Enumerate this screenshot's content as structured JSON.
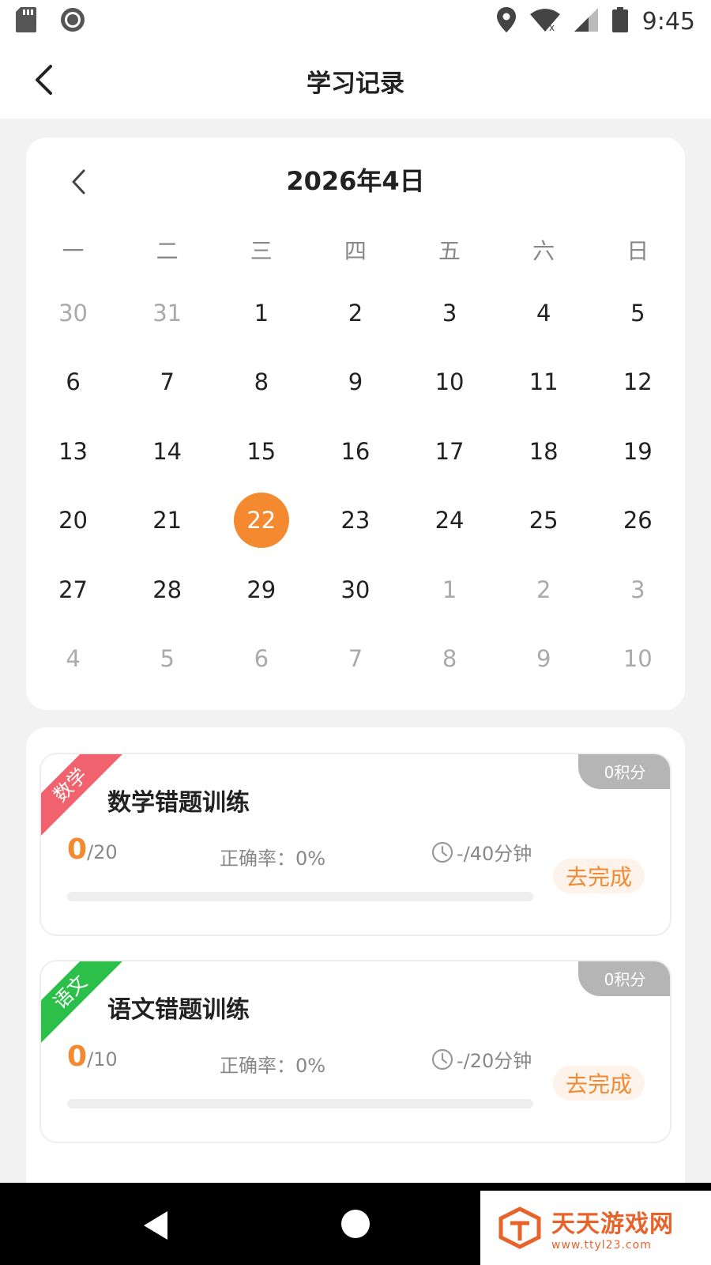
{
  "status_bar": {
    "time": "9:45"
  },
  "nav": {
    "title": "学习记录"
  },
  "calendar": {
    "title": "2026年4日",
    "weekdays": [
      "一",
      "二",
      "三",
      "四",
      "五",
      "六",
      "日"
    ],
    "days": [
      {
        "label": "30",
        "muted": true
      },
      {
        "label": "31",
        "muted": true
      },
      {
        "label": "1"
      },
      {
        "label": "2"
      },
      {
        "label": "3"
      },
      {
        "label": "4"
      },
      {
        "label": "5"
      },
      {
        "label": "6"
      },
      {
        "label": "7"
      },
      {
        "label": "8"
      },
      {
        "label": "9"
      },
      {
        "label": "10"
      },
      {
        "label": "11"
      },
      {
        "label": "12"
      },
      {
        "label": "13"
      },
      {
        "label": "14"
      },
      {
        "label": "15"
      },
      {
        "label": "16"
      },
      {
        "label": "17"
      },
      {
        "label": "18"
      },
      {
        "label": "19"
      },
      {
        "label": "20"
      },
      {
        "label": "21"
      },
      {
        "label": "22",
        "selected": true
      },
      {
        "label": "23"
      },
      {
        "label": "24"
      },
      {
        "label": "25"
      },
      {
        "label": "26"
      },
      {
        "label": "27"
      },
      {
        "label": "28"
      },
      {
        "label": "29"
      },
      {
        "label": "30"
      },
      {
        "label": "1",
        "muted": true
      },
      {
        "label": "2",
        "muted": true
      },
      {
        "label": "3",
        "muted": true
      },
      {
        "label": "4",
        "muted": true
      },
      {
        "label": "5",
        "muted": true
      },
      {
        "label": "6",
        "muted": true
      },
      {
        "label": "7",
        "muted": true
      },
      {
        "label": "8",
        "muted": true
      },
      {
        "label": "9",
        "muted": true
      },
      {
        "label": "10",
        "muted": true
      }
    ]
  },
  "tasks": [
    {
      "subject": "数学",
      "subject_color": "#f0636e",
      "points": "0积分",
      "title": "数学错题训练",
      "done": "0",
      "total": "/20",
      "accuracy": "正确率：0%",
      "time": "-/40分钟",
      "progress": 0,
      "action": "去完成"
    },
    {
      "subject": "语文",
      "subject_color": "#2cbf4a",
      "points": "0积分",
      "title": "语文错题训练",
      "done": "0",
      "total": "/10",
      "accuracy": "正确率：0%",
      "time": "-/20分钟",
      "progress": 0,
      "action": "去完成"
    }
  ],
  "watermark": {
    "main": "天天游戏网",
    "sub": "www.ttyl23.com"
  },
  "colors": {
    "accent": "#f5892f"
  }
}
